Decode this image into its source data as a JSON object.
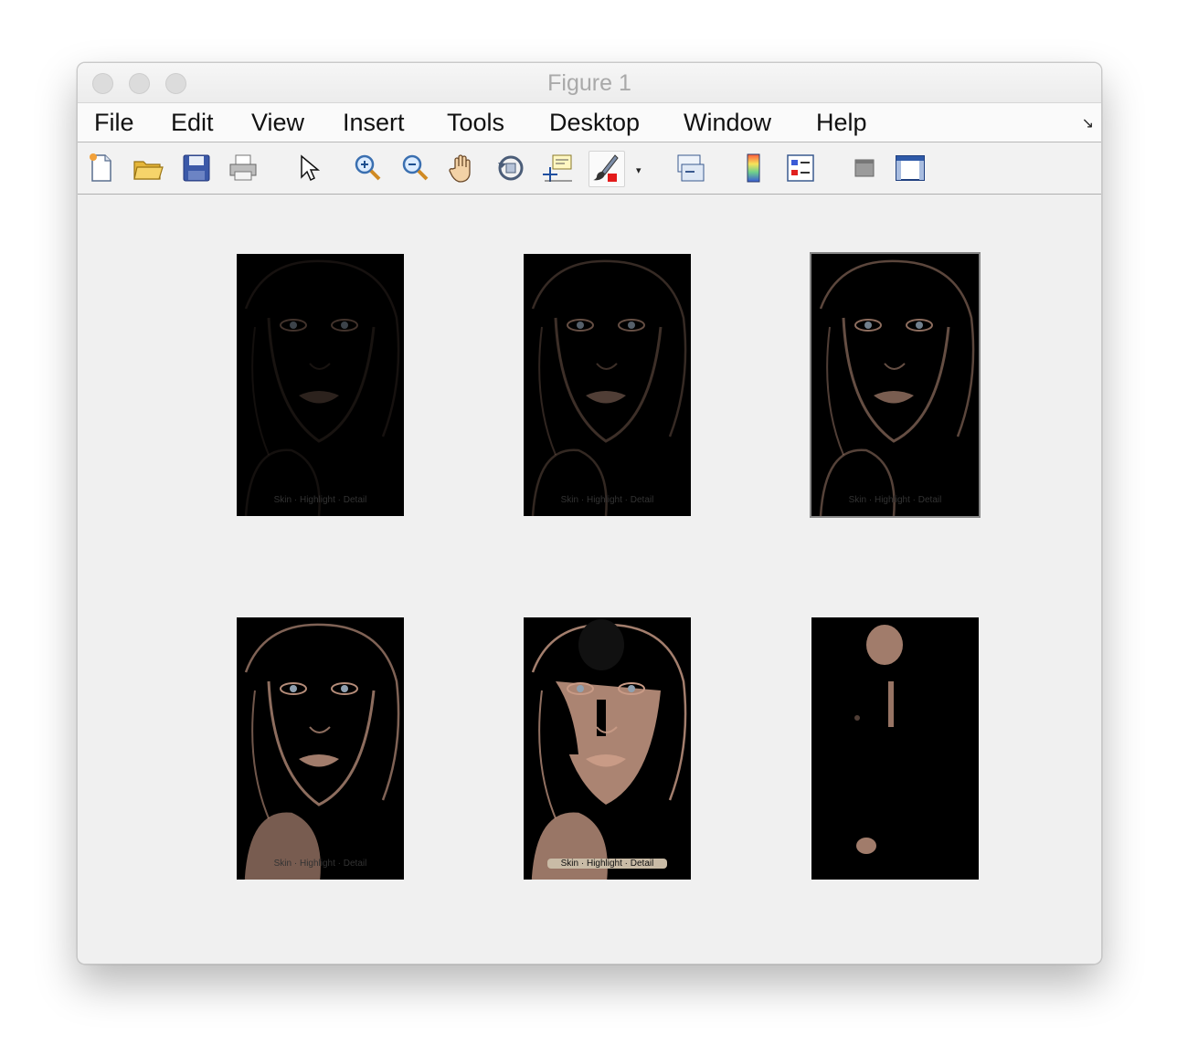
{
  "window": {
    "title": "Figure 1"
  },
  "menu": {
    "items": [
      {
        "label": "File"
      },
      {
        "label": "Edit"
      },
      {
        "label": "View"
      },
      {
        "label": "Insert"
      },
      {
        "label": "Tools"
      },
      {
        "label": "Desktop"
      },
      {
        "label": "Window"
      },
      {
        "label": "Help"
      }
    ],
    "corner_icon": "dock-arrow-icon"
  },
  "toolbar": {
    "buttons": [
      {
        "icon": "new-figure-icon"
      },
      {
        "icon": "open-file-icon"
      },
      {
        "icon": "save-icon"
      },
      {
        "icon": "print-icon"
      },
      {
        "icon": "edit-plot-arrow-icon"
      },
      {
        "icon": "zoom-in-icon"
      },
      {
        "icon": "zoom-out-icon"
      },
      {
        "icon": "pan-hand-icon"
      },
      {
        "icon": "rotate-3d-icon"
      },
      {
        "icon": "data-cursor-icon"
      },
      {
        "icon": "brush-icon"
      },
      {
        "icon": "link-plot-icon"
      },
      {
        "icon": "colorbar-icon"
      },
      {
        "icon": "legend-icon"
      },
      {
        "icon": "hide-plot-tools-icon"
      },
      {
        "icon": "show-plot-tools-icon"
      }
    ]
  },
  "subplots": [
    {
      "caption": "Skin · Highlight · Detail",
      "skin_level": 0.12
    },
    {
      "caption": "Skin · Highlight · Detail",
      "skin_level": 0.3
    },
    {
      "caption": "Skin · Highlight · Detail",
      "skin_level": 0.5
    },
    {
      "caption": "Skin · Highlight · Detail",
      "skin_level": 0.7
    },
    {
      "caption": "Skin · Highlight · Detail",
      "skin_level": 0.9
    },
    {
      "caption": "",
      "skin_level": 0.4
    }
  ],
  "colors": {
    "skin": "#c99b86",
    "window_bg": "#f0f0f0",
    "panel_bg": "#000000"
  }
}
